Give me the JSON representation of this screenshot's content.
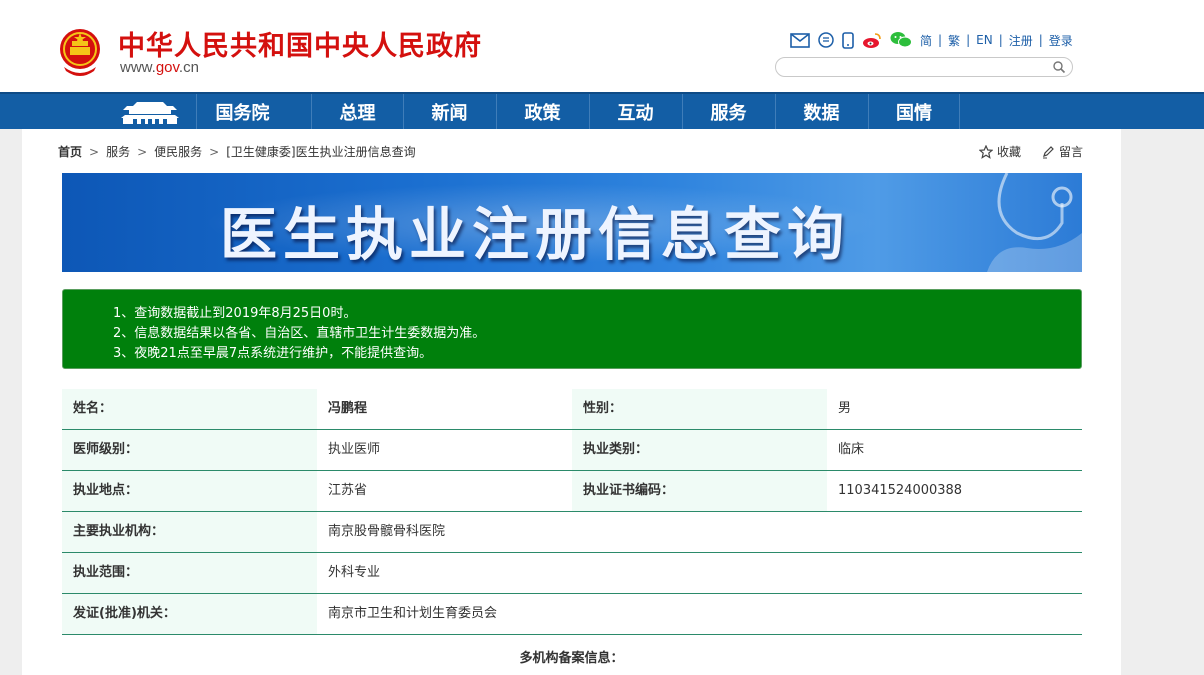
{
  "header": {
    "site_title": "中华人民共和国中央人民政府",
    "site_domain_prefix": "www.",
    "site_domain_highlight": "gov",
    "site_domain_suffix": ".cn",
    "links": {
      "simplified": "简",
      "traditional": "繁",
      "english": "EN",
      "register": "注册",
      "login": "登录"
    },
    "search": {
      "placeholder": ""
    }
  },
  "nav": {
    "items": [
      "国务院",
      "总理",
      "新闻",
      "政策",
      "互动",
      "服务",
      "数据",
      "国情"
    ]
  },
  "breadcrumb": {
    "items": [
      "首页",
      "服务",
      "便民服务",
      "[卫生健康委]医生执业注册信息查询"
    ],
    "separator": ">"
  },
  "actions": {
    "favorite": "收藏",
    "message": "留言"
  },
  "banner": {
    "title": "医生执业注册信息查询"
  },
  "notice": {
    "lines": [
      "1、查询数据截止到2019年8月25日0时。",
      "2、信息数据结果以各省、自治区、直辖市卫生计生委数据为准。",
      "3、夜晚21点至早晨7点系统进行维护，不能提供查询。"
    ]
  },
  "info": {
    "name_label": "姓名：",
    "name_value": "冯鹏程",
    "gender_label": "性别：",
    "gender_value": "男",
    "level_label": "医师级别：",
    "level_value": "执业医师",
    "category_label": "执业类别：",
    "category_value": "临床",
    "location_label": "执业地点：",
    "location_value": "江苏省",
    "cert_label": "执业证书编码：",
    "cert_value": "110341524000388",
    "org_label": "主要执业机构：",
    "org_value": "南京股骨髋骨科医院",
    "scope_label": "执业范围：",
    "scope_value": "外科专业",
    "issuer_label": "发证(批准)机关：",
    "issuer_value": "南京市卫生和计划生育委员会",
    "multi_title": "多机构备案信息："
  },
  "colors": {
    "brand_red": "#d4100e",
    "nav_blue": "#135ea5",
    "notice_green": "#00800c",
    "row_border": "#2b8a6a",
    "label_bg": "#f0fbf6"
  }
}
